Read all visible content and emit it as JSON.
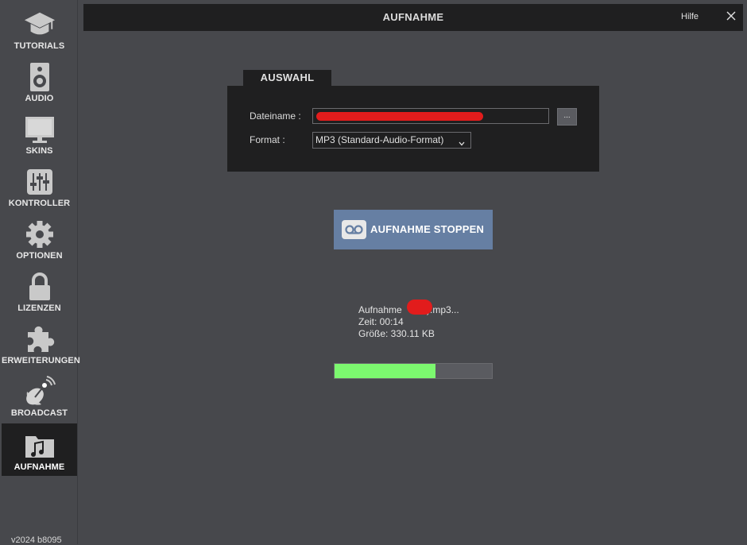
{
  "sidebar": {
    "items": [
      {
        "label": "TUTORIALS",
        "icon": "graduation-cap-icon"
      },
      {
        "label": "AUDIO",
        "icon": "speaker-icon"
      },
      {
        "label": "SKINS",
        "icon": "monitor-icon"
      },
      {
        "label": "KONTROLLER",
        "icon": "mixer-sliders-icon"
      },
      {
        "label": "OPTIONEN",
        "icon": "gear-icon"
      },
      {
        "label": "LIZENZEN",
        "icon": "lock-icon"
      },
      {
        "label": "ERWEITERUNGEN",
        "icon": "puzzle-icon"
      },
      {
        "label": "BROADCAST",
        "icon": "satellite-dish-icon"
      },
      {
        "label": "AUFNAHME",
        "icon": "music-folder-icon",
        "active": true
      }
    ],
    "version": "v2024 b8095"
  },
  "header": {
    "title": "AUFNAHME",
    "help_label": "Hilfe",
    "close_icon": "close-icon"
  },
  "selection": {
    "tab_label": "AUSWAHL",
    "filename_label": "Dateiname :",
    "filename_value": "",
    "browse_label": "...",
    "format_label": "Format :",
    "format_value": "MP3 (Standard-Audio-Format)"
  },
  "record_button": {
    "label": "AUFNAHME STOPPEN",
    "icon": "voicemail-icon",
    "color": "#667fa3"
  },
  "status": {
    "file_prefix": "Aufnahme ",
    "file_suffix": ").mp3...",
    "time": "Zeit: 00:14",
    "size": "Größe: 330.11 KB",
    "progress_percent": 64,
    "progress_color": "#7cf86f"
  }
}
